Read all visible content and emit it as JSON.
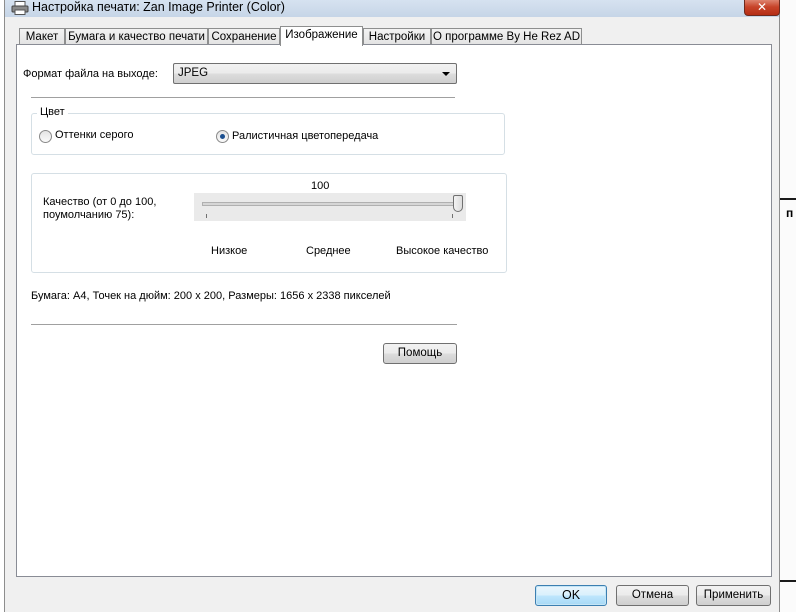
{
  "window": {
    "title": "Настройка печати: Zan Image Printer (Color)",
    "close_label": "✕"
  },
  "tabs": [
    {
      "label": "Макет"
    },
    {
      "label": "Бумага и качество печати"
    },
    {
      "label": "Сохранение"
    },
    {
      "label": "Изображение",
      "active": true
    },
    {
      "label": "Настройки"
    },
    {
      "label": "О программе By He Rez AD"
    }
  ],
  "format": {
    "label": "Формат файла на выходе:",
    "value": "JPEG"
  },
  "color_group": {
    "title": "Цвет",
    "options": [
      {
        "label": "Оттенки серого",
        "selected": false
      },
      {
        "label": "Ралистичная цветопередача",
        "selected": true
      }
    ]
  },
  "quality": {
    "label_line1": "Качество (от 0 до 100,",
    "label_line2": "поумолчанию 75):",
    "value_text": "100",
    "value": 100,
    "min": 0,
    "max": 100,
    "low_label": "Низкое",
    "mid_label": "Среднее",
    "high_label": "Высокое качество"
  },
  "info_text": "Бумага: A4, Точек на дюйм: 200 x 200, Размеры: 1656 x 2338 пикселей",
  "buttons": {
    "help": "Помощь",
    "ok": "OK",
    "cancel": "Отмена",
    "apply": "Применить"
  },
  "background_fragment": "п"
}
